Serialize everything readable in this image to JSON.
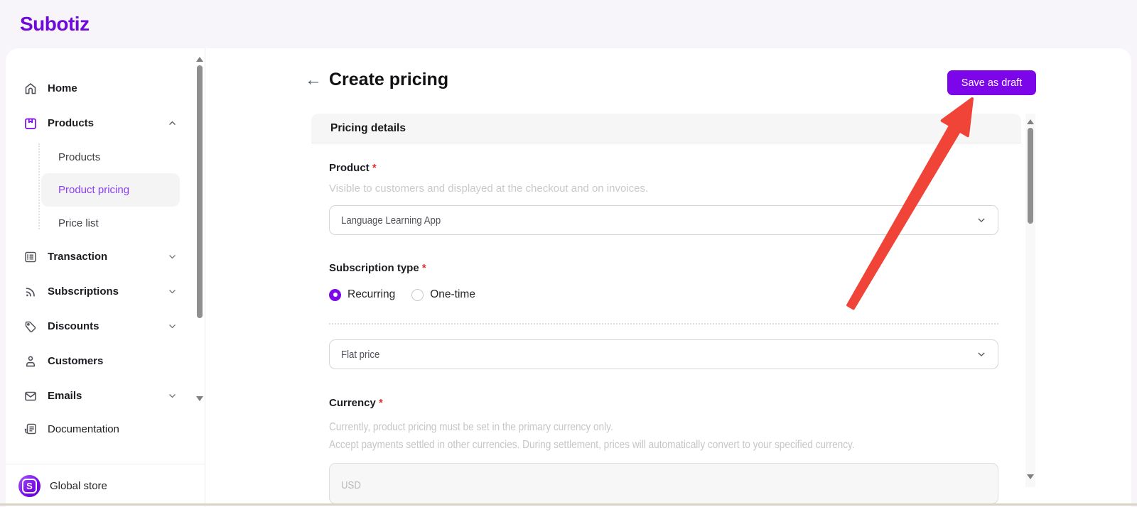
{
  "brand": {
    "logo": "Subotiz"
  },
  "colors": {
    "accent": "#7d05e9",
    "logo": "#6e09db",
    "active_link": "#8b3df5",
    "annotation_arrow": "#f04438",
    "required_asterisk": "#e02d2d"
  },
  "sidebar": {
    "items": [
      {
        "label": "Home",
        "icon": "home-icon"
      },
      {
        "label": "Products",
        "icon": "package-icon",
        "expanded": true
      },
      {
        "label": "Transaction",
        "icon": "receipt-list-icon"
      },
      {
        "label": "Subscriptions",
        "icon": "feed-icon"
      },
      {
        "label": "Discounts",
        "icon": "tag-icon"
      },
      {
        "label": "Customers",
        "icon": "person-icon"
      },
      {
        "label": "Emails",
        "icon": "mail-icon"
      },
      {
        "label": "Documentation",
        "icon": "document-icon"
      }
    ],
    "sub_items": [
      {
        "label": "Products",
        "active": false
      },
      {
        "label": "Product pricing",
        "active": true
      },
      {
        "label": "Price list",
        "active": false
      }
    ],
    "footer": {
      "store_name": "Global store",
      "badge_letter": "S"
    }
  },
  "header": {
    "back_icon": "←",
    "title": "Create pricing",
    "save_button": "Save as draft"
  },
  "form": {
    "section_title": "Pricing details",
    "required_mark": "*",
    "product": {
      "label": "Product",
      "helper": "Visible to customers and displayed at the checkout and on invoices.",
      "value": "Language Learning App"
    },
    "subscription_type": {
      "label": "Subscription type",
      "options": [
        {
          "label": "Recurring",
          "selected": true
        },
        {
          "label": "One-time",
          "selected": false
        }
      ]
    },
    "price_model": {
      "value": "Flat price"
    },
    "currency": {
      "label": "Currency",
      "helper_line1": "Currently, product pricing must be set in the primary currency only.",
      "helper_line2": "Accept payments settled in other currencies. During settlement, prices will automatically convert to your specified currency.",
      "value": "USD"
    }
  }
}
